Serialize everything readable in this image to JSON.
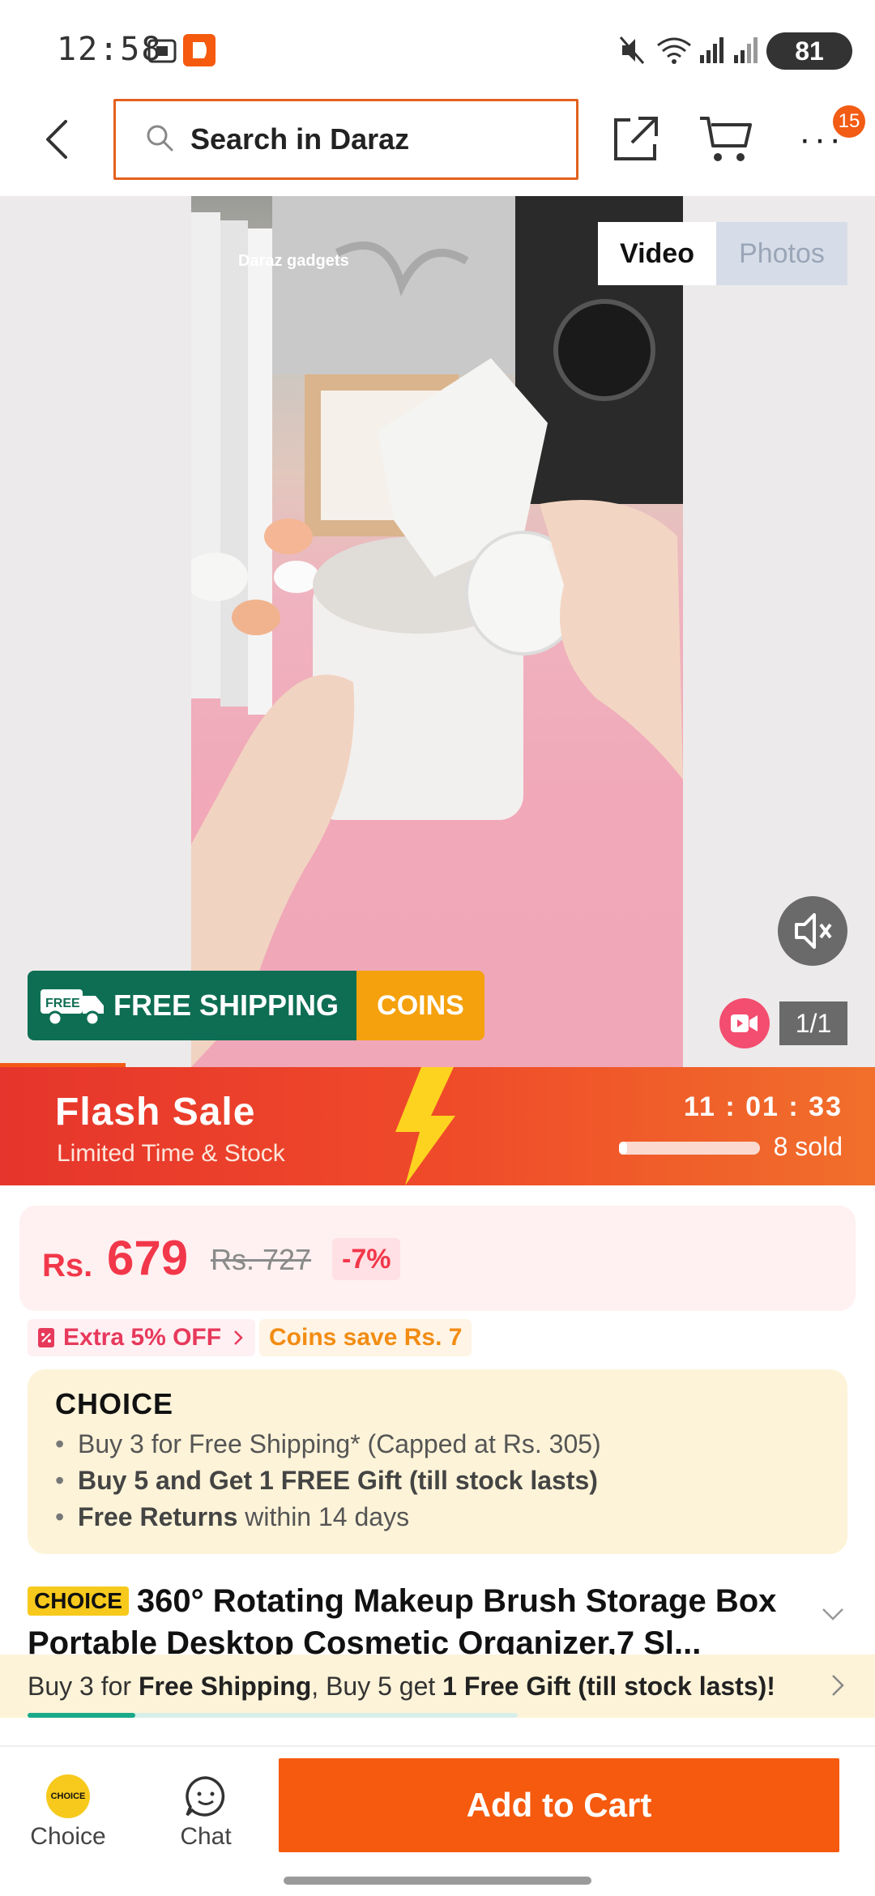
{
  "status_bar": {
    "time": "12:58",
    "battery": "81",
    "icons": [
      "screenshot-icon",
      "daraz-app-icon",
      "mute-icon",
      "wifi-icon",
      "signal-icon",
      "signal-icon"
    ]
  },
  "header": {
    "search_placeholder": "Search in Daraz",
    "cart_badge": "15",
    "more_label": "···"
  },
  "media": {
    "tabs": [
      {
        "label": "Video",
        "active": true
      },
      {
        "label": "Photos",
        "active": false
      }
    ],
    "watermark": "Daraz gadgets",
    "counter": "1/1",
    "free_shipping_label": "FREE SHIPPING",
    "free_badge": "FREE",
    "coins_label": "COINS"
  },
  "flash_sale": {
    "title": "Flash Sale",
    "subtitle": "Limited Time & Stock",
    "timer": "11 : 01 : 33",
    "sold": "8 sold",
    "sold_progress": 0.06
  },
  "price": {
    "currency": "Rs.",
    "current": "679",
    "original": "Rs. 727",
    "discount": "-7%"
  },
  "promos": {
    "extra_off": "Extra 5% OFF",
    "coins_save": "Coins save Rs. 7"
  },
  "choice": {
    "logo": "CHOICE",
    "items": [
      {
        "bold": "",
        "text": "Buy 3 for  Free Shipping* (Capped at Rs. 305)"
      },
      {
        "bold": "Buy 5 and Get 1 FREE Gift (till stock lasts)",
        "text": ""
      },
      {
        "bold": "Free Returns",
        "text": " within 14 days"
      }
    ]
  },
  "product": {
    "tag": "CHOICE",
    "title": "360° Rotating Makeup Brush Storage Box Portable Desktop Cosmetic Organizer,7 Sl..."
  },
  "bundle": {
    "prefix": "Buy 3 for ",
    "b1": "Free Shipping",
    "mid": ", Buy 5 get ",
    "b2": "1 Free Gift (till stock lasts)!",
    "progress": 0.22
  },
  "bottom_bar": {
    "choice_label": "Choice",
    "choice_icon_text": "CHOICE",
    "chat_label": "Chat",
    "add_to_cart": "Add to Cart"
  },
  "colors": {
    "brand_orange": "#f55a0e",
    "flash_red": "#e6352c",
    "price_red": "#f2374a",
    "choice_yellow": "#f7c91c",
    "free_ship_green": "#0e6e53"
  }
}
